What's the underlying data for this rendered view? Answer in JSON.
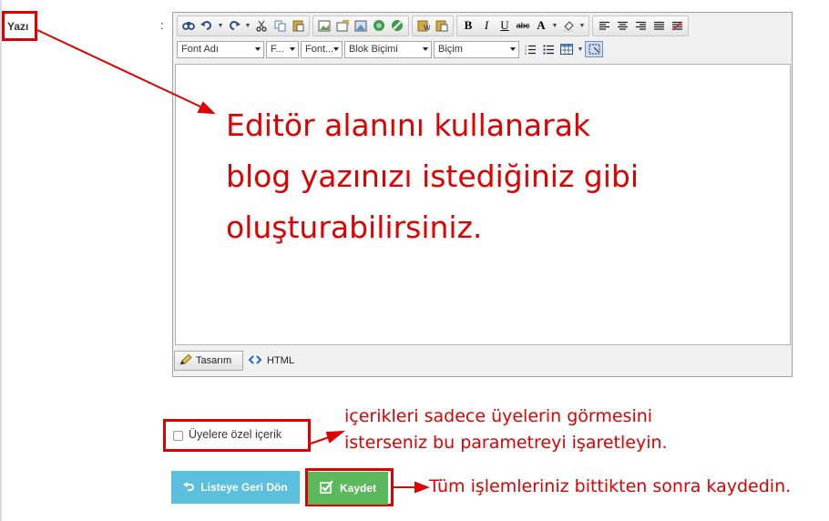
{
  "field": {
    "label": "Yazı",
    "colon": ":"
  },
  "toolbar": {
    "row1": {
      "group1": [
        "find-icon",
        "undo-icon",
        "redo-icon",
        "cut-icon",
        "copy-icon",
        "paste-icon"
      ],
      "group2": [
        "image-icon",
        "image-manager-icon",
        "image-map-icon",
        "link-icon",
        "unlink-icon"
      ],
      "group3": [
        "paste-word-icon",
        "paste-text-icon"
      ],
      "format": {
        "bold": "B",
        "italic": "I",
        "underline": "U",
        "strikethrough": "abc",
        "fore_color": "A"
      },
      "align": [
        "align-left-icon",
        "align-center-icon",
        "align-right-icon",
        "justify-icon",
        "strip-format-icon"
      ]
    },
    "row2": {
      "font_name": "Font Adı",
      "font_size": "F...",
      "font_format": "Font...",
      "block_format": "Blok Biçimi",
      "style": "Biçim"
    }
  },
  "editor": {
    "mode_design": "Tasarım",
    "mode_html": "HTML"
  },
  "annotations": {
    "editor_lines": [
      "Editör alanını kullanarak",
      "blog yazınızı istediğiniz gibi",
      "oluşturabilirsiniz."
    ],
    "checkbox_lines": [
      "içerikleri sadece üyelerin görmesini",
      "isterseniz bu parametreyi işaretleyin."
    ],
    "save": "Tüm işlemleriniz bittikten sonra kaydedin."
  },
  "members_only": {
    "label": "Üyelere özel içerik",
    "checked": false
  },
  "buttons": {
    "back": "Listeye Geri Dön",
    "save": "Kaydet"
  },
  "colors": {
    "annotation": "#e00000",
    "info": "#5bc0de",
    "success": "#5cb85c"
  }
}
